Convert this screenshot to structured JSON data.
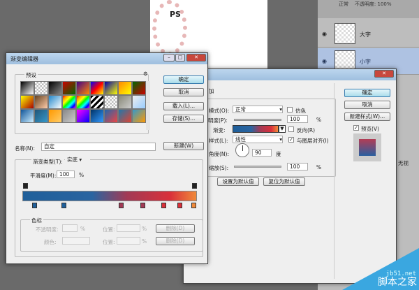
{
  "canvas": {
    "text": "PS"
  },
  "layers_panel": {
    "blend_mode": "正常",
    "opacity_label": "不透明度:",
    "opacity": "100%",
    "layers": [
      {
        "name": "大字"
      },
      {
        "name": "小字"
      }
    ],
    "side_text": "无视"
  },
  "gradient_editor": {
    "title": "渐变编辑器",
    "presets_label": "预设",
    "buttons": {
      "ok": "确定",
      "cancel": "取消",
      "load": "载入(L)...",
      "save": "存储(S)...",
      "new": "新建(W)"
    },
    "name_label": "名称(N):",
    "name_value": "自定",
    "type_label": "渐变类型(T):",
    "type_value": "实底",
    "smooth_label": "平滑度(M):",
    "smooth_value": "100",
    "percent": "%",
    "presets": [
      "#000-#fff",
      "checker-black",
      "#000-#888",
      "#c00-#060",
      "#408-#f80",
      "#00f-#f00-#ff0",
      "#00a-#ff0",
      "#f80-#ff0",
      "#060-#c00",
      "#ff0-#a00",
      "#642-#fca",
      "#28c-#fff",
      "rainbow",
      "rainbow2",
      "stripes",
      "checker",
      "#887-#ccc",
      "#eee-#9cf",
      "#159-#cef",
      "#257-#39c",
      "#f90-#fc6",
      "#888-#ccc",
      "#f0f-#00f",
      "#036-#39f",
      "#26a-#e44",
      "#27a-#d43",
      "#39c-#f90"
    ],
    "stops_group": "色标",
    "opacity_label": "不透明度:",
    "color_label": "颜色:",
    "position_label": "位置:",
    "delete": "删除(D)",
    "colors": {
      "start": "#1f5f9a",
      "mid": "#a23a55",
      "red": "#d9303a",
      "end": "#f08a3a"
    }
  },
  "layer_style": {
    "section": "加",
    "mode_label": "模式(O):",
    "mode_value": "正常",
    "dither": "仿色",
    "opacity_label": "不透明度(P):",
    "opacity_value": "100",
    "percent": "%",
    "gradient_label": "渐变:",
    "reverse": "反向(R)",
    "style_label": "样式(L):",
    "style_value": "线性",
    "align": "与图层对齐(I)",
    "angle_label": "角度(N):",
    "angle_value": "90",
    "degree": "度",
    "scale_label": "缩放(S):",
    "scale_value": "100",
    "set_default": "设置为默认值",
    "reset_default": "复位为默认值",
    "ok": "确定",
    "cancel": "取消",
    "new_style": "新建样式(W)...",
    "preview": "预览(V)"
  },
  "watermark": {
    "site": "jb51.net",
    "name": "脚本之家"
  }
}
